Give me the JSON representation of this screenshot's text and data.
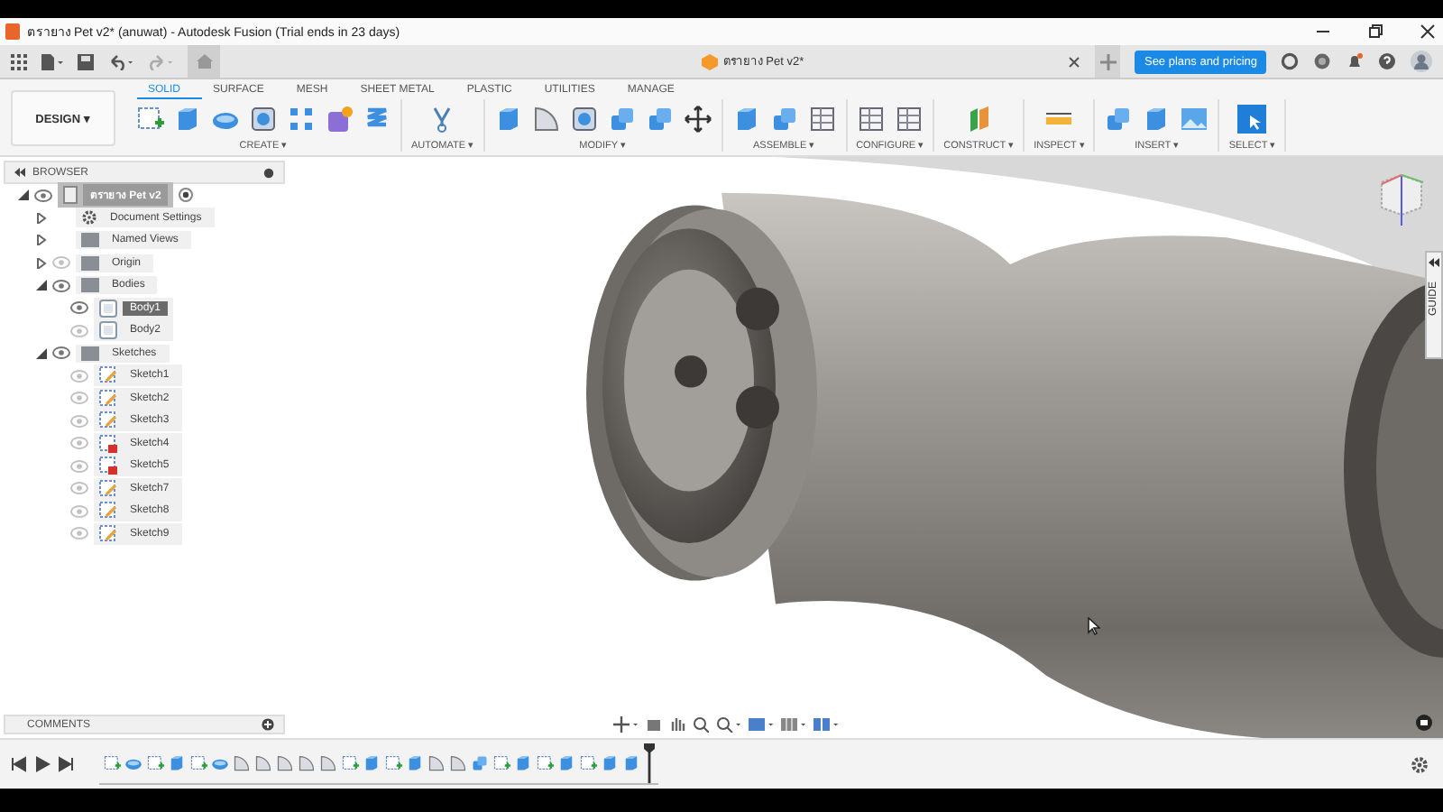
{
  "window": {
    "title": "ตรายาง Pet v2* (anuwat) - Autodesk Fusion (Trial ends in 23 days)"
  },
  "document_tab": {
    "title": "ตรายาง Pet v2*"
  },
  "upgrade_button": "See plans and pricing",
  "workspace": "DESIGN ▾",
  "tabs": [
    {
      "label": "SOLID",
      "selected": true
    },
    {
      "label": "SURFACE",
      "selected": false
    },
    {
      "label": "MESH",
      "selected": false
    },
    {
      "label": "SHEET METAL",
      "selected": false
    },
    {
      "label": "PLASTIC",
      "selected": false
    },
    {
      "label": "UTILITIES",
      "selected": false
    },
    {
      "label": "MANAGE",
      "selected": false
    }
  ],
  "tool_groups": [
    {
      "label": "CREATE ▾",
      "tools": [
        {
          "kind": "sketch"
        },
        {
          "kind": "extrude"
        },
        {
          "kind": "revolve"
        },
        {
          "kind": "hole"
        },
        {
          "kind": "pattern"
        },
        {
          "kind": "form"
        },
        {
          "kind": "coil"
        }
      ]
    },
    {
      "label": "AUTOMATE ▾",
      "tools": [
        {
          "kind": "script"
        }
      ]
    },
    {
      "label": "MODIFY ▾",
      "tools": [
        {
          "kind": "presspull"
        },
        {
          "kind": "fillet"
        },
        {
          "kind": "shell"
        },
        {
          "kind": "combine"
        },
        {
          "kind": "offset"
        },
        {
          "kind": "move"
        }
      ]
    },
    {
      "label": "ASSEMBLE ▾",
      "tools": [
        {
          "kind": "component"
        },
        {
          "kind": "joint"
        },
        {
          "kind": "table"
        }
      ]
    },
    {
      "label": "CONFIGURE ▾",
      "tools": [
        {
          "kind": "configure"
        },
        {
          "kind": "table"
        }
      ]
    },
    {
      "label": "CONSTRUCT ▾",
      "tools": [
        {
          "kind": "plane"
        }
      ]
    },
    {
      "label": "INSPECT ▾",
      "tools": [
        {
          "kind": "measure"
        }
      ]
    },
    {
      "label": "INSERT ▾",
      "tools": [
        {
          "kind": "derive"
        },
        {
          "kind": "insertmesh"
        },
        {
          "kind": "canvas"
        }
      ]
    },
    {
      "label": "SELECT ▾",
      "tools": [
        {
          "kind": "select"
        }
      ]
    }
  ],
  "browser": {
    "title": "BROWSER",
    "tree": [
      {
        "label": "ตรายาง Pet v2",
        "kind": "document",
        "visible": true,
        "expanded": true,
        "selected": false,
        "children": [
          {
            "label": "Document Settings",
            "kind": "settings",
            "expanded": false,
            "selected": false
          },
          {
            "label": "Named Views",
            "kind": "folder",
            "expanded": false,
            "selected": false
          },
          {
            "label": "Origin",
            "kind": "folder",
            "visible": false,
            "expanded": false,
            "selected": false
          },
          {
            "label": "Bodies",
            "kind": "folder",
            "visible": true,
            "expanded": true,
            "selected": false,
            "children": [
              {
                "label": "Body1",
                "kind": "body",
                "visible": true,
                "selected": true
              },
              {
                "label": "Body2",
                "kind": "body",
                "visible": false,
                "selected": false
              }
            ]
          },
          {
            "label": "Sketches",
            "kind": "folder",
            "visible": true,
            "expanded": true,
            "selected": false,
            "children": [
              {
                "label": "Sketch1",
                "kind": "sketch",
                "visible": false,
                "selected": false
              },
              {
                "label": "Sketch2",
                "kind": "sketch",
                "visible": false,
                "selected": false
              },
              {
                "label": "Sketch3",
                "kind": "sketch",
                "visible": false,
                "selected": false
              },
              {
                "label": "Sketch4",
                "kind": "flaggedsketch",
                "visible": false,
                "selected": false
              },
              {
                "label": "Sketch5",
                "kind": "flaggedsketch",
                "visible": false,
                "selected": false
              },
              {
                "label": "Sketch7",
                "kind": "sketch",
                "visible": false,
                "selected": false
              },
              {
                "label": "Sketch8",
                "kind": "sketch",
                "visible": false,
                "selected": false
              },
              {
                "label": "Sketch9",
                "kind": "sketch",
                "visible": false,
                "selected": false
              }
            ]
          }
        ]
      }
    ]
  },
  "side_panel": {
    "label": "GUIDE"
  },
  "comments": {
    "title": "COMMENTS"
  },
  "timeline": [
    {
      "kind": "sketch"
    },
    {
      "kind": "revolve"
    },
    {
      "kind": "sketch"
    },
    {
      "kind": "extrude"
    },
    {
      "kind": "sketch"
    },
    {
      "kind": "revolve"
    },
    {
      "kind": "fillet"
    },
    {
      "kind": "fillet"
    },
    {
      "kind": "fillet"
    },
    {
      "kind": "fillet"
    },
    {
      "kind": "fillet"
    },
    {
      "kind": "sketch"
    },
    {
      "kind": "extrude"
    },
    {
      "kind": "sketch"
    },
    {
      "kind": "extrude"
    },
    {
      "kind": "fillet"
    },
    {
      "kind": "fillet"
    },
    {
      "kind": "combine"
    },
    {
      "kind": "sketch"
    },
    {
      "kind": "extrude"
    },
    {
      "kind": "sketch"
    },
    {
      "kind": "extrude"
    },
    {
      "kind": "sketch"
    },
    {
      "kind": "extrude"
    },
    {
      "kind": "extrude"
    }
  ]
}
